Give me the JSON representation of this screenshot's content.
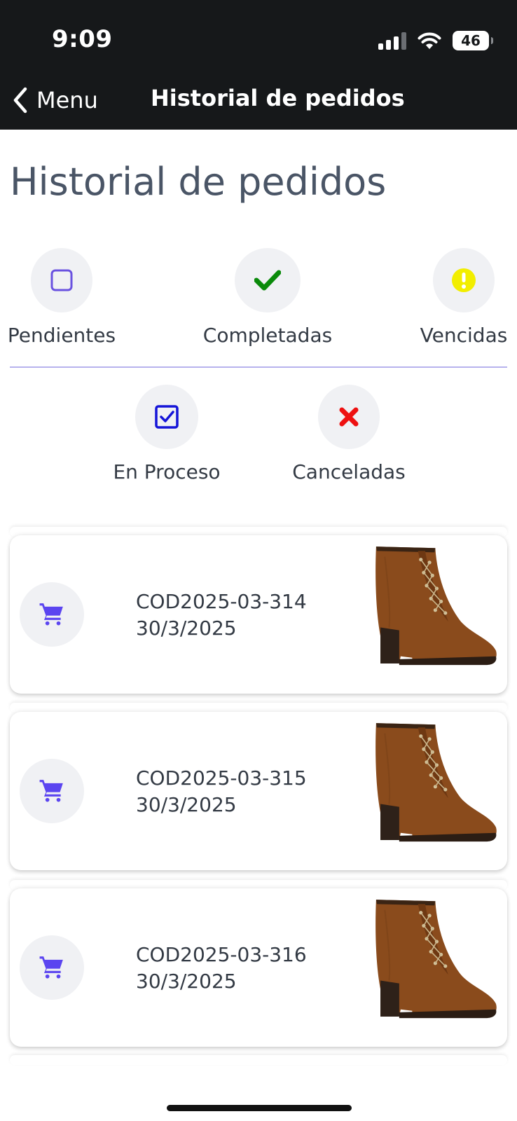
{
  "status_bar": {
    "time": "9:09",
    "battery": "46"
  },
  "nav": {
    "back_label": "Menu",
    "title": "Historial de pedidos"
  },
  "page": {
    "title": "Historial de pedidos"
  },
  "filters": [
    {
      "label": "Pendientes",
      "icon": "square-outline-icon",
      "color": "#6a52e0"
    },
    {
      "label": "Completadas",
      "icon": "checkmark-icon",
      "color": "#0a8a0a"
    },
    {
      "label": "Vencidas",
      "icon": "exclamation-icon",
      "color": "#f2ee00"
    },
    {
      "label": "En Proceso",
      "icon": "checked-box-icon",
      "color": "#1414d8"
    },
    {
      "label": "Canceladas",
      "icon": "x-icon",
      "color": "#ee1111"
    }
  ],
  "orders": [
    {
      "code": "COD2025-03-314",
      "date": "30/3/2025",
      "icon": "cart-icon",
      "image": "brown-boot"
    },
    {
      "code": "COD2025-03-315",
      "date": "30/3/2025",
      "icon": "cart-icon",
      "image": "brown-boot"
    },
    {
      "code": "COD2025-03-316",
      "date": "30/3/2025",
      "icon": "cart-icon",
      "image": "brown-boot"
    }
  ],
  "colors": {
    "accent": "#5b45f0",
    "header_bg": "#16181a",
    "title": "#4a5566",
    "divider": "#b7b2ee"
  }
}
